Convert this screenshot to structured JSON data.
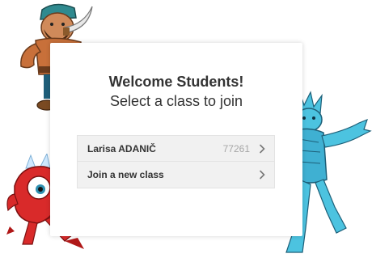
{
  "welcome": {
    "title": "Welcome Students!",
    "subtitle": "Select a class to join"
  },
  "classes": [
    {
      "teacher": "Larisa ADANIČ",
      "code": "77261"
    }
  ],
  "join_new": {
    "label": "Join a new class"
  },
  "icons": {
    "row_chevron": "chevron-right-icon"
  },
  "colors": {
    "row_background": "#f1f1f1",
    "code_text": "#a6a6a6",
    "pirate_skin": "#c8703a",
    "monster_red": "#d92a2a",
    "ice_blue": "#4cc3e0"
  }
}
